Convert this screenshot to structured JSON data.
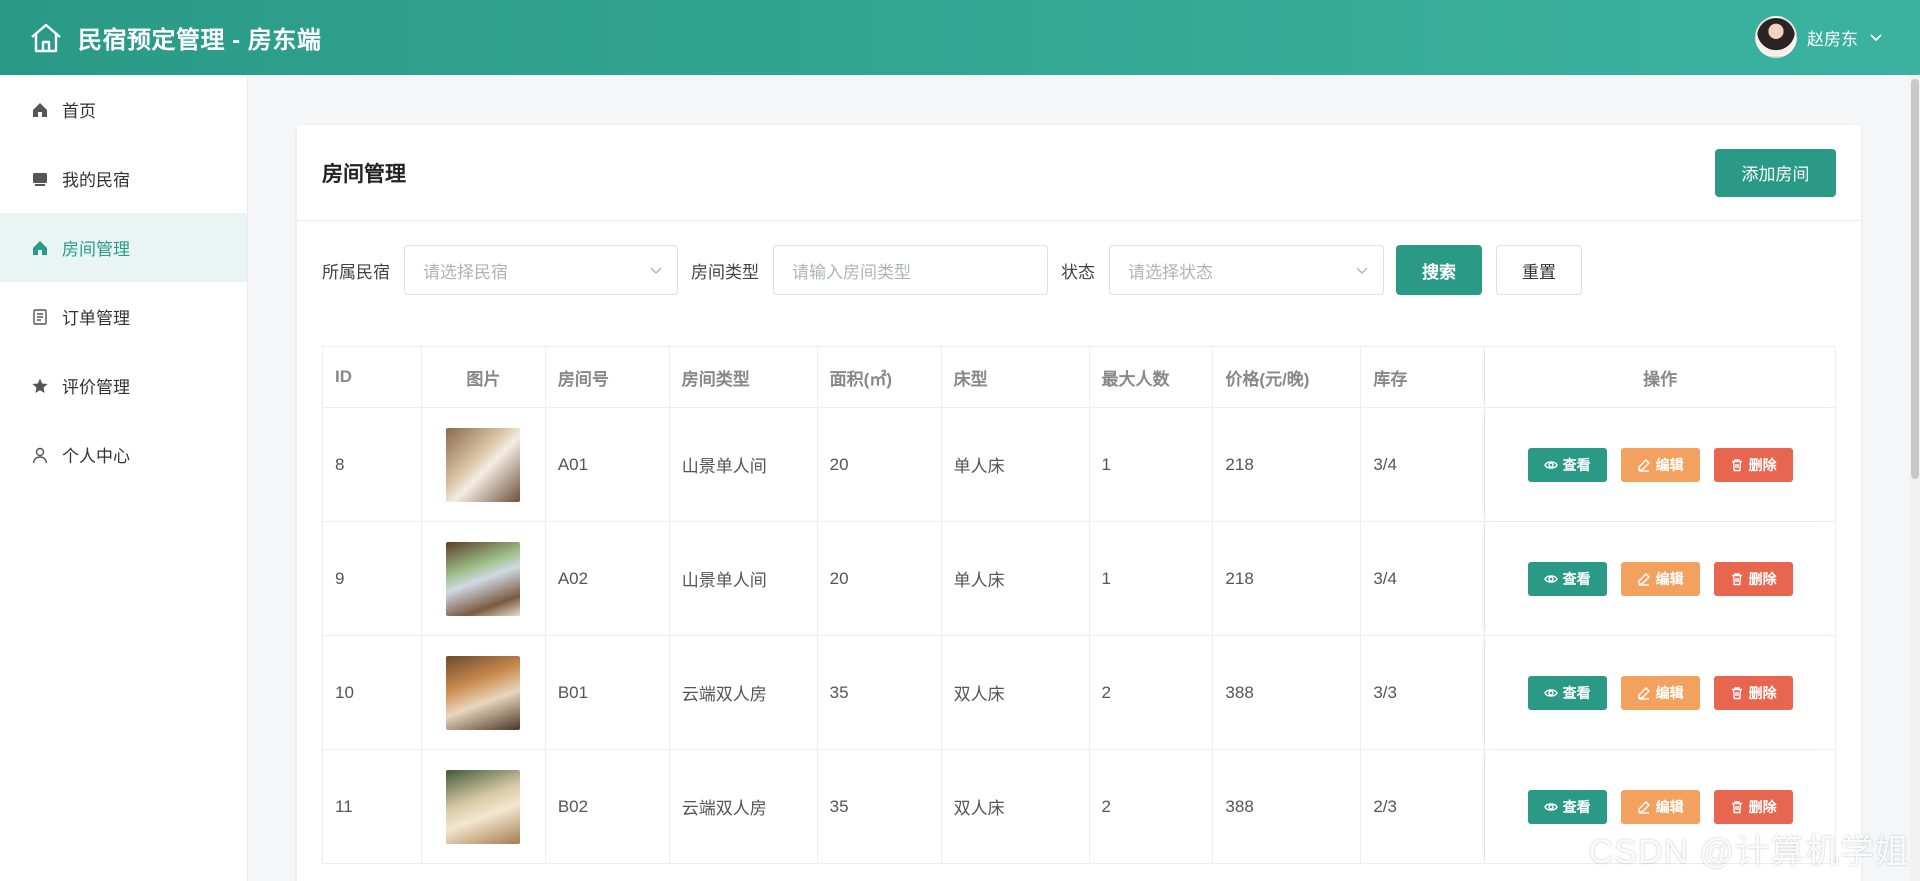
{
  "header": {
    "title": "民宿预定管理 - 房东端",
    "user_name": "赵房东"
  },
  "sidebar": {
    "items": [
      {
        "label": "首页",
        "icon": "home-icon"
      },
      {
        "label": "我的民宿",
        "icon": "shop-icon"
      },
      {
        "label": "房间管理",
        "icon": "home-icon",
        "active": true
      },
      {
        "label": "订单管理",
        "icon": "document-icon"
      },
      {
        "label": "评价管理",
        "icon": "star-icon"
      },
      {
        "label": "个人中心",
        "icon": "user-icon"
      }
    ]
  },
  "card": {
    "title": "房间管理",
    "add_button": "添加房间"
  },
  "filters": {
    "homestay_label": "所属民宿",
    "homestay_placeholder": "请选择民宿",
    "type_label": "房间类型",
    "type_placeholder": "请输入房间类型",
    "status_label": "状态",
    "status_placeholder": "请选择状态",
    "search_button": "搜索",
    "reset_button": "重置"
  },
  "table": {
    "headers": [
      "ID",
      "图片",
      "房间号",
      "房间类型",
      "面积(㎡)",
      "床型",
      "最大人数",
      "价格(元/晚)",
      "库存",
      "操作"
    ],
    "rows": [
      {
        "id": "8",
        "room_no": "A01",
        "type": "山景单人间",
        "area": "20",
        "bed": "单人床",
        "max": "1",
        "price": "218",
        "stock": "3/4"
      },
      {
        "id": "9",
        "room_no": "A02",
        "type": "山景单人间",
        "area": "20",
        "bed": "单人床",
        "max": "1",
        "price": "218",
        "stock": "3/4"
      },
      {
        "id": "10",
        "room_no": "B01",
        "type": "云端双人房",
        "area": "35",
        "bed": "双人床",
        "max": "2",
        "price": "388",
        "stock": "3/3"
      },
      {
        "id": "11",
        "room_no": "B02",
        "type": "云端双人房",
        "area": "35",
        "bed": "双人床",
        "max": "2",
        "price": "388",
        "stock": "2/3"
      }
    ],
    "actions": {
      "view": "查看",
      "edit": "编辑",
      "delete": "删除"
    }
  },
  "watermark": "CSDN @计算机学姐",
  "colors": {
    "primary": "#2a9a87",
    "warning": "#f3a15f",
    "danger": "#e8654f"
  }
}
